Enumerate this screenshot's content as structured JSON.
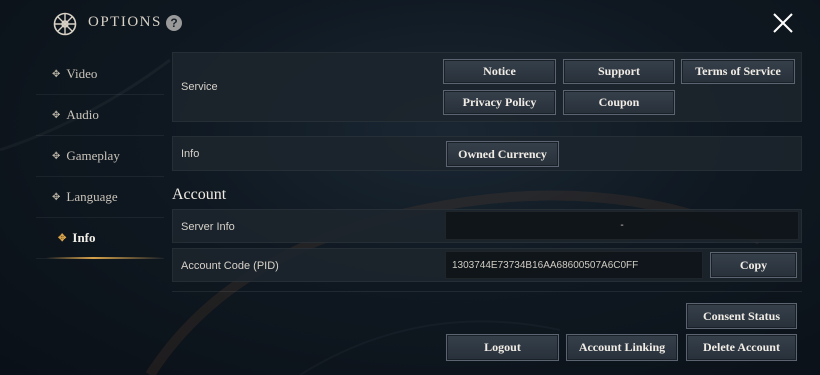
{
  "header": {
    "title": "OPTIONS",
    "help_glyph": "?",
    "icons": [
      "gear-icon",
      "help-icon",
      "close-icon"
    ]
  },
  "sidebar": {
    "items": [
      {
        "label": "Video"
      },
      {
        "label": "Audio"
      },
      {
        "label": "Gameplay"
      },
      {
        "label": "Language"
      },
      {
        "label": "Info",
        "active": true
      }
    ]
  },
  "service": {
    "label": "Service",
    "buttons": {
      "notice": "Notice",
      "support": "Support",
      "terms": "Terms of Service",
      "privacy": "Privacy Policy",
      "coupon": "Coupon"
    }
  },
  "info": {
    "label": "Info",
    "owned_currency": "Owned Currency"
  },
  "account": {
    "title": "Account",
    "server_info_label": "Server Info",
    "server_info_value": "-",
    "account_code_label": "Account Code (PID)",
    "account_code_value": "1303744E73734B16AA68600507A6C0FF",
    "copy": "Copy",
    "consent_status": "Consent Status",
    "logout": "Logout",
    "account_linking": "Account Linking",
    "delete_account": "Delete Account"
  },
  "colors": {
    "accent": "#d6a24a",
    "panel": "#1d242c",
    "background": "#0f1821"
  }
}
